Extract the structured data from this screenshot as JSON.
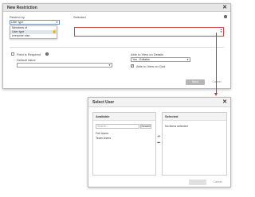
{
  "dialog1": {
    "title": "New Restriction",
    "restrict_by_label": "Restrict by",
    "restrict_by_value": "User type",
    "dropdown_options": [
      "Members of",
      "User type",
      "everyone else"
    ],
    "selected_label": "Selected",
    "field_required_label": "Field is Required",
    "default_value_label": "Default Value",
    "able_to_view_label": "Able to View on Details",
    "able_to_view_value": "Yes - Editable",
    "able_to_view_grid_label": "Able to View on Grid",
    "save_label": "Save",
    "cancel_label": "Cancel"
  },
  "dialog2": {
    "title": "Select User",
    "available_label": "Available",
    "selected_label": "Selected",
    "search_placeholder": "Search...",
    "search_button": "Search",
    "items": [
      "Full Users",
      "Team Users"
    ],
    "no_items_text": "No items selected",
    "add_arrow": "➔",
    "remove_arrow": "⬅"
  },
  "colors": {
    "accent_red": "#c0392b",
    "header_grey": "#e6e6e6"
  }
}
